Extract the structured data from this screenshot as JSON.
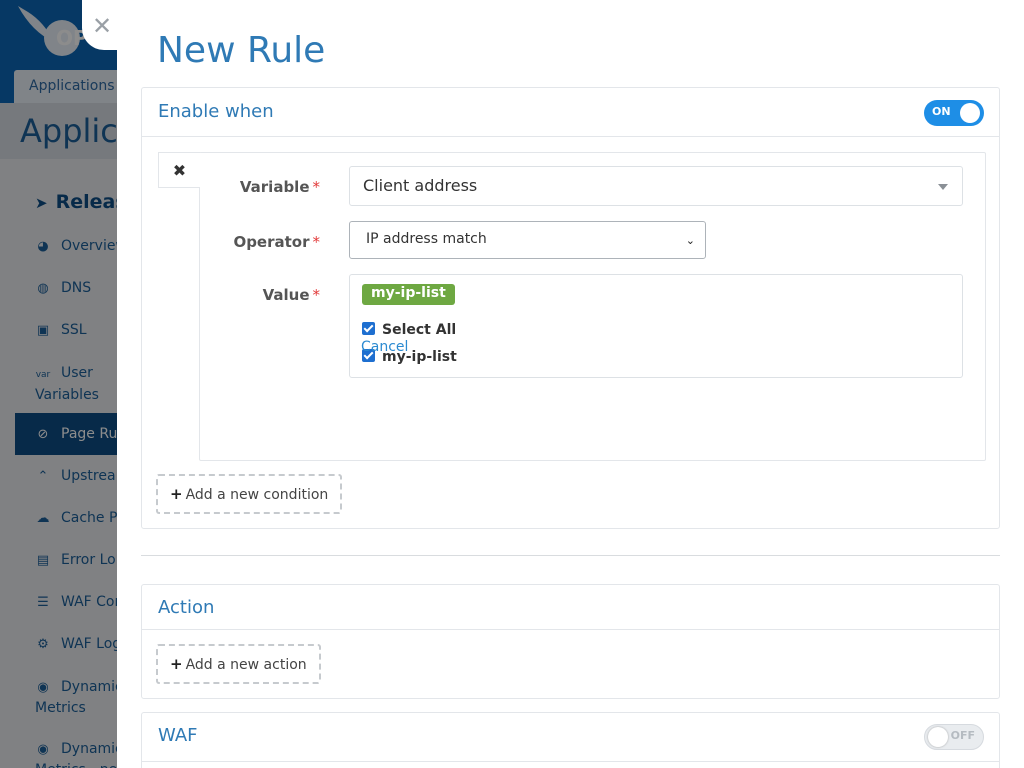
{
  "background": {
    "logo_text": "OP",
    "tab_label": "Applications",
    "page_title": "Applica",
    "nav_release": "Releas",
    "nav_items": [
      {
        "label": "Overview",
        "icon": "gauge-icon"
      },
      {
        "label": "DNS",
        "icon": "globe-icon"
      },
      {
        "label": "SSL",
        "icon": "certificate-icon"
      },
      {
        "label": "User Variables",
        "icon": "var-icon"
      },
      {
        "label": "Page Ru",
        "icon": "page-rules-icon"
      },
      {
        "label": "Upstrea",
        "icon": "upstream-icon"
      },
      {
        "label": "Cache P",
        "icon": "cache-icon"
      },
      {
        "label": "Error Lo",
        "icon": "error-log-icon"
      },
      {
        "label": "WAF Cor",
        "icon": "waf-config-icon"
      },
      {
        "label": "WAF Log",
        "icon": "waf-log-icon"
      },
      {
        "label": "Dynamic Metrics",
        "icon": "metrics-icon"
      },
      {
        "label": "Dynamic Metrics - ne",
        "icon": "metrics-icon"
      }
    ]
  },
  "drawer": {
    "close_symbol": "✕",
    "title": "New Rule",
    "enable_when": {
      "title": "Enable when",
      "toggle_label": "ON",
      "toggle_state": true,
      "condition": {
        "remove_symbol": "✖",
        "variable_label": "Variable",
        "variable_value": "Client address",
        "operator_label": "Operator",
        "operator_value": "IP address match",
        "value_label": "Value",
        "required_mark": "*",
        "selected_tag": "my-ip-list",
        "options": [
          {
            "label": "Select All",
            "checked": true
          },
          {
            "label": "my-ip-list",
            "checked": true
          }
        ],
        "cancel_label": "Cancel"
      },
      "add_condition_label": "Add a new condition"
    },
    "action": {
      "title": "Action",
      "add_action_label": "Add a new action"
    },
    "waf": {
      "title": "WAF",
      "toggle_label": "OFF",
      "toggle_state": false
    }
  },
  "colors": {
    "accent": "#2f7ab5",
    "toggle_on": "#1e8ee6",
    "tag_green": "#6ea842",
    "required_red": "#e23a3a"
  }
}
